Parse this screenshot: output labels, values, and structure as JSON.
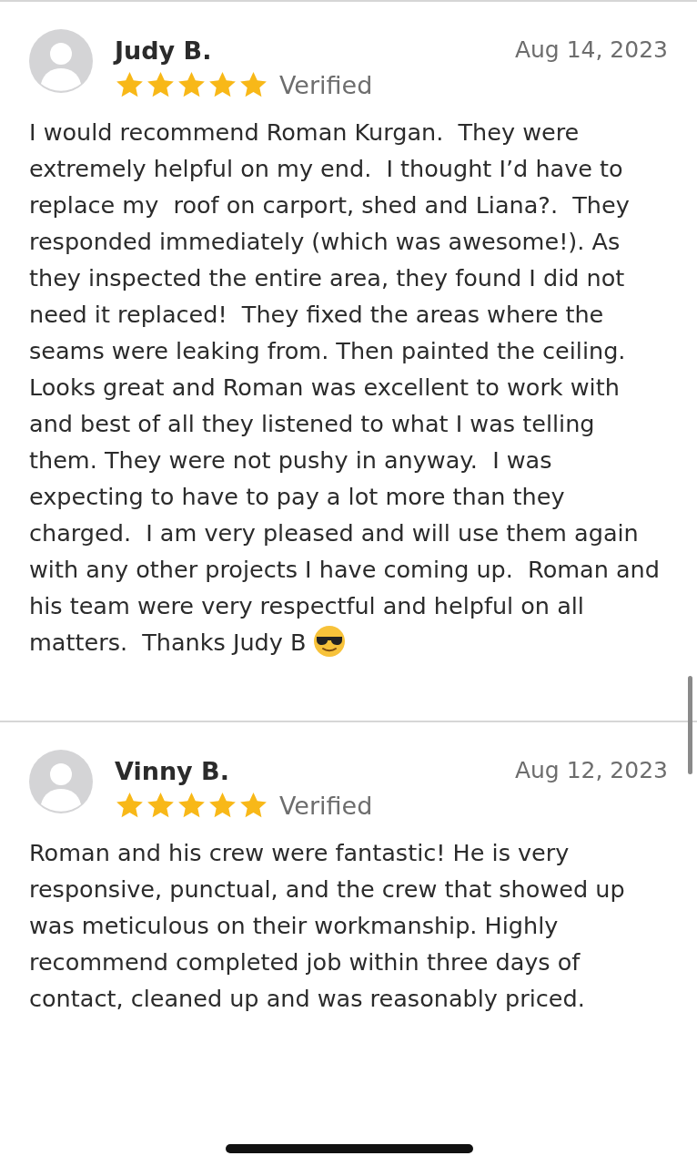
{
  "reviews": [
    {
      "name": "Judy B.",
      "date": "Aug 14, 2023",
      "stars": 5,
      "badge": "Verified",
      "text": "I would recommend Roman Kurgan.  They were extremely helpful on my end.  I thought I’d have to replace my  roof on carport, shed and Liana?.  They responded immediately (which was awesome!). As they inspected the entire area, they found I did not need it replaced!  They fixed the areas where the seams were leaking from. Then painted the ceiling.  Looks great and Roman was excellent to work with and best of all they listened to what I was telling them. They were not pushy in anyway.  I was expecting to have to pay a lot more than they charged.  I am very pleased and will use them again with any other projects I have coming up.  Roman and his team were very respectful and helpful on all matters.  Thanks Judy B",
      "emoji": true
    },
    {
      "name": "Vinny B.",
      "date": "Aug 12, 2023",
      "stars": 5,
      "badge": "Verified",
      "text": "Roman and his crew were fantastic! He is very responsive, punctual, and the crew that showed up was meticulous on their workmanship. Highly recommend completed job within three days of contact, cleaned up and was reasonably priced.",
      "emoji": false
    }
  ]
}
